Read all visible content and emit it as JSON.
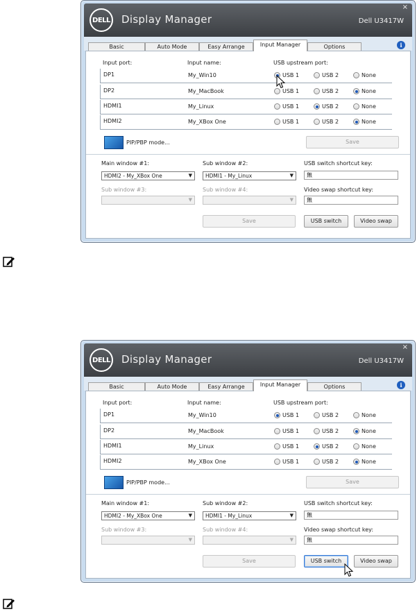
{
  "windows": [
    {
      "brand": "DELL",
      "title": "Display Manager",
      "model": "Dell U3417W",
      "close": "×",
      "tabs": [
        "Basic",
        "Auto Mode",
        "Easy Arrange",
        "Input Manager",
        "Options"
      ],
      "active_tab": "Input Manager",
      "info": "i",
      "headers": {
        "port": "Input port:",
        "name": "Input name:",
        "usb": "USB upstream port:"
      },
      "rows": [
        {
          "port": "DP1",
          "name": "My_Win10",
          "selected": "USB 1"
        },
        {
          "port": "DP2",
          "name": "My_MacBook",
          "selected": "None"
        },
        {
          "port": "HDMI1",
          "name": "My_Linux",
          "selected": "USB 2"
        },
        {
          "port": "HDMI2",
          "name": "My_XBox One",
          "selected": "None"
        }
      ],
      "usb_options": [
        "USB 1",
        "USB 2",
        "None"
      ],
      "pip_label": "PIP/PBP mode...",
      "save_top": "Save",
      "main1_label": "Main window #1:",
      "main1_value": "HDMI2 - My_XBox One",
      "sub2_label": "Sub window #2:",
      "sub2_value": "HDMI1 - My_Linux",
      "sub3_label": "Sub window #3:",
      "sub4_label": "Sub window #4:",
      "usb_key_label": "USB switch shortcut key:",
      "usb_key_value": "無",
      "video_key_label": "Video swap shortcut key:",
      "video_key_value": "無",
      "save_bottom": "Save",
      "usb_switch": "USB switch",
      "video_swap": "Video swap"
    },
    {
      "brand": "DELL",
      "title": "Display Manager",
      "model": "Dell U3417W",
      "close": "×",
      "tabs": [
        "Basic",
        "Auto Mode",
        "Easy Arrange",
        "Input Manager",
        "Options"
      ],
      "active_tab": "Input Manager",
      "info": "i",
      "headers": {
        "port": "Input port:",
        "name": "Input name:",
        "usb": "USB upstream port:"
      },
      "rows": [
        {
          "port": "DP1",
          "name": "My_Win10",
          "selected": "USB 1"
        },
        {
          "port": "DP2",
          "name": "My_MacBook",
          "selected": "None"
        },
        {
          "port": "HDMI1",
          "name": "My_Linux",
          "selected": "USB 2"
        },
        {
          "port": "HDMI2",
          "name": "My_XBox One",
          "selected": "None"
        }
      ],
      "usb_options": [
        "USB 1",
        "USB 2",
        "None"
      ],
      "pip_label": "PIP/PBP mode...",
      "save_top": "Save",
      "main1_label": "Main window #1:",
      "main1_value": "HDMI2 - My_XBox One",
      "sub2_label": "Sub window #2:",
      "sub2_value": "HDMI1 - My_Linux",
      "sub3_label": "Sub window #3:",
      "sub4_label": "Sub window #4:",
      "usb_key_label": "USB switch shortcut key:",
      "usb_key_value": "無",
      "video_key_label": "Video swap shortcut key:",
      "video_key_value": "無",
      "save_bottom": "Save",
      "usb_switch": "USB switch",
      "video_swap": "Video swap"
    }
  ],
  "colors": {
    "accent": "#1d58b8",
    "titlebar": "#46494d",
    "frame": "#c9dcef"
  },
  "icons": [
    "dell-logo",
    "info-icon",
    "close-icon",
    "pip-icon",
    "dropdown-arrow-icon",
    "note-pencil-icon",
    "mouse-cursor-icon"
  ]
}
